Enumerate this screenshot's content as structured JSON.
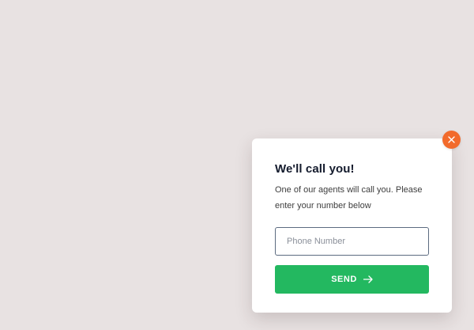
{
  "colors": {
    "page_background": "#e8e2e2",
    "close_button": "#f26a2b",
    "send_button": "#23b860",
    "title_text": "#141b2d"
  },
  "popup": {
    "title": "We'll call you!",
    "description": "One of our agents will call you. Please enter your number below",
    "phone_input": {
      "value": "",
      "placeholder": "Phone Number"
    },
    "send_button_label": "SEND",
    "icons": {
      "close": "close-icon",
      "send": "arrow-right-icon"
    }
  }
}
